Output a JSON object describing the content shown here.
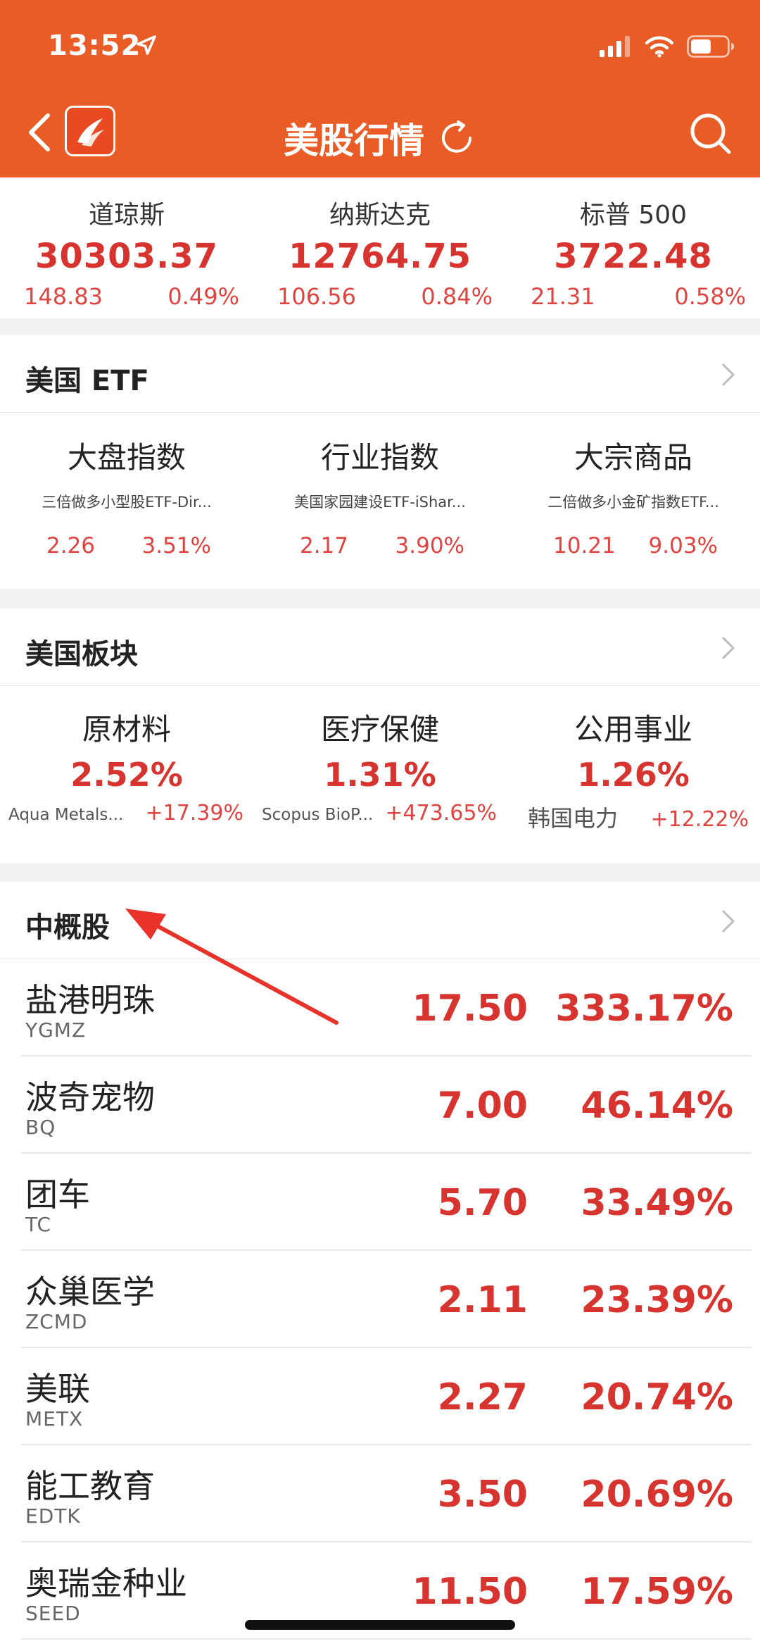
{
  "status_bar": {
    "time": "13:52"
  },
  "nav": {
    "title": "美股行情"
  },
  "indices": [
    {
      "name": "道琼斯",
      "value": "30303.37",
      "change": "148.83",
      "pct": "0.49%"
    },
    {
      "name": "纳斯达克",
      "value": "12764.75",
      "change": "106.56",
      "pct": "0.84%"
    },
    {
      "name": "标普 500",
      "value": "3722.48",
      "change": "21.31",
      "pct": "0.58%"
    }
  ],
  "etf_section": {
    "title": "美国 ETF",
    "items": [
      {
        "name": "大盘指数",
        "desc": "三倍做多小型股ETF-Dir...",
        "price": "2.26",
        "pct": "3.51%"
      },
      {
        "name": "行业指数",
        "desc": "美国家园建设ETF-iShar...",
        "price": "2.17",
        "pct": "3.90%"
      },
      {
        "name": "大宗商品",
        "desc": "二倍做多小金矿指数ETF...",
        "price": "10.21",
        "pct": "9.03%"
      }
    ]
  },
  "sector_section": {
    "title": "美国板块",
    "items": [
      {
        "name": "原材料",
        "pct": "2.52%",
        "leader": "Aqua Metals...",
        "leader_pct": "+17.39%"
      },
      {
        "name": "医疗保健",
        "pct": "1.31%",
        "leader": "Scopus BioP...",
        "leader_pct": "+473.65%"
      },
      {
        "name": "公用事业",
        "pct": "1.26%",
        "leader": "韩国电力",
        "leader_pct": "+12.22%"
      }
    ]
  },
  "china_section": {
    "title": "中概股",
    "stocks": [
      {
        "name": "盐港明珠",
        "code": "YGMZ",
        "price": "17.50",
        "pct": "333.17%"
      },
      {
        "name": "波奇宠物",
        "code": "BQ",
        "price": "7.00",
        "pct": "46.14%"
      },
      {
        "name": "团车",
        "code": "TC",
        "price": "5.70",
        "pct": "33.49%"
      },
      {
        "name": "众巢医学",
        "code": "ZCMD",
        "price": "2.11",
        "pct": "23.39%"
      },
      {
        "name": "美联",
        "code": "METX",
        "price": "2.27",
        "pct": "20.74%"
      },
      {
        "name": "能工教育",
        "code": "EDTK",
        "price": "3.50",
        "pct": "20.69%"
      },
      {
        "name": "奥瑞金种业",
        "code": "SEED",
        "price": "11.50",
        "pct": "17.59%"
      }
    ]
  },
  "colors": {
    "header": "#e95c25",
    "up": "#d8342f",
    "annotation": "#e8322a"
  },
  "icons": [
    "location-arrow-icon",
    "cellular-signal-icon",
    "wifi-icon",
    "battery-icon",
    "back-chevron-icon",
    "app-logo-icon",
    "refresh-icon",
    "search-icon",
    "chevron-right-icon"
  ]
}
